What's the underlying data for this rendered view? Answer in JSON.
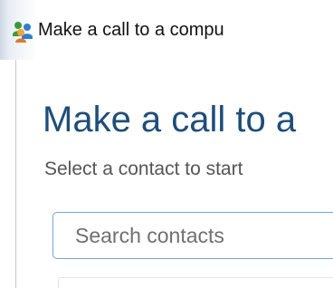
{
  "window": {
    "title": "Make a call to a compu",
    "icon": "people-contacts-icon"
  },
  "main": {
    "heading": "Make a call to a",
    "subtitle": "Select a contact to start"
  },
  "search": {
    "placeholder": "Search contacts",
    "value": ""
  },
  "colors": {
    "heading": "#1e4e79",
    "search_border": "#6fa8d6"
  }
}
